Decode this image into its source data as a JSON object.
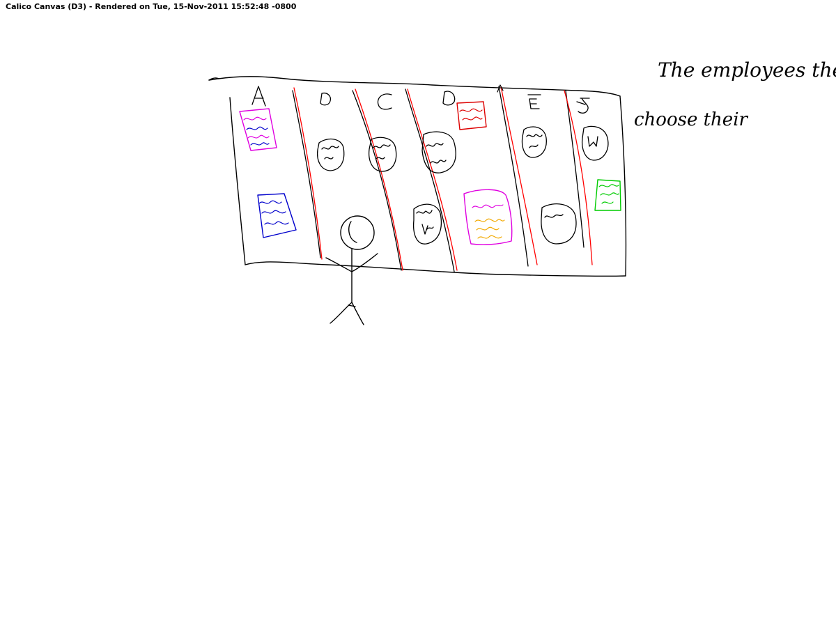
{
  "header": {
    "title": "Calico Canvas (D3) - Rendered on Tue, 15-Nov-2011 15:52:48 -0800"
  },
  "sketch": {
    "column_labels": [
      "A",
      "B",
      "C",
      "D",
      "E",
      "F"
    ],
    "note_line_1": "The employees then",
    "note_line_2": "choose their"
  },
  "colors": {
    "ink": "#000000",
    "divider": "#ff0000",
    "magenta": "#e000e0",
    "blue": "#0000cc",
    "red": "#dd0000",
    "green": "#00cc00",
    "orange": "#f2a900"
  }
}
